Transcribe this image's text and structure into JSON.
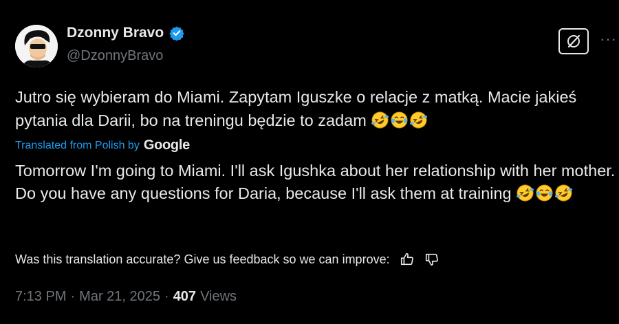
{
  "author": {
    "display_name": "Dzonny Bravo",
    "handle": "@DzonnyBravo"
  },
  "tweet": {
    "text": "Jutro się wybieram do Miami. Zapytam Iguszke o relacje z matką. Macie jakieś pytania dla Darii, bo na treningu będzie to zadam",
    "emojis": [
      "rolling-on-floor-laughing",
      "tears-of-joy",
      "rolling-on-floor-laughing"
    ]
  },
  "translation": {
    "label": "Translated from Polish by",
    "provider": "Google",
    "text": "Tomorrow I'm going to Miami. I'll ask Igushka about her relationship with her mother. Do you have any questions for Daria, because I'll ask them at training",
    "feedback_prompt": "Was this translation accurate? Give us feedback so we can improve:"
  },
  "meta": {
    "time": "7:13 PM",
    "separator": "·",
    "date": "Mar 21, 2025",
    "views_count": "407",
    "views_label": "Views"
  },
  "icons": {
    "verified": "verified-badge-icon",
    "grok": "grok-icon",
    "more": "more-icon",
    "thumbs_up": "thumbs-up-icon",
    "thumbs_down": "thumbs-down-icon"
  },
  "colors": {
    "background": "#000000",
    "text": "#e7e9ea",
    "secondary": "#71767b",
    "accent": "#1d9bf0"
  }
}
